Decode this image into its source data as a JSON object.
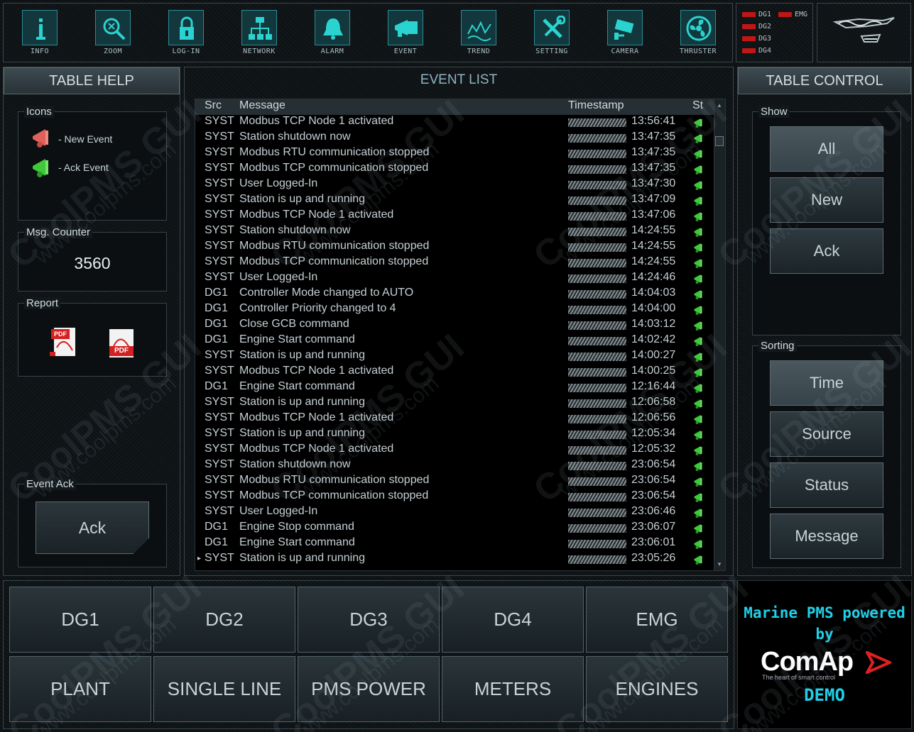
{
  "toolbar": {
    "items": [
      {
        "label": "INFO",
        "icon": "info-icon"
      },
      {
        "label": "ZOOM",
        "icon": "zoom-icon"
      },
      {
        "label": "LOG-IN",
        "icon": "lock-icon"
      },
      {
        "label": "NETWORK",
        "icon": "network-icon"
      },
      {
        "label": "ALARM",
        "icon": "bell-icon"
      },
      {
        "label": "EVENT",
        "icon": "horn-icon"
      },
      {
        "label": "TREND",
        "icon": "trend-icon"
      },
      {
        "label": "SETTING",
        "icon": "tools-icon"
      },
      {
        "label": "CAMERA",
        "icon": "camera-icon"
      },
      {
        "label": "THRUSTER",
        "icon": "fan-icon"
      }
    ]
  },
  "gen_status": {
    "dg1": "DG1",
    "dg2": "DG2",
    "dg3": "DG3",
    "dg4": "DG4",
    "emg": "EMG",
    "color": "#c11616"
  },
  "left": {
    "title": "TABLE HELP",
    "icons_title": "Icons",
    "new_event": "- New Event",
    "ack_event": "- Ack Event",
    "counter_title": "Msg. Counter",
    "counter_value": "3560",
    "report_title": "Report",
    "pdf1_label": "PDF",
    "pdf2_label": "PDF",
    "ack_title": "Event Ack",
    "ack_button": "Ack"
  },
  "center": {
    "title": "EVENT LIST",
    "columns": {
      "src": "Src",
      "message": "Message",
      "timestamp": "Timestamp",
      "status": "St"
    },
    "rows": [
      {
        "src": "SYST",
        "msg": "Modbus TCP Node 1 activated",
        "time": "13:56:41"
      },
      {
        "src": "SYST",
        "msg": "Station shutdown now",
        "time": "13:47:35"
      },
      {
        "src": "SYST",
        "msg": "Modbus RTU communication stopped",
        "time": "13:47:35"
      },
      {
        "src": "SYST",
        "msg": "Modbus TCP communication stopped",
        "time": "13:47:35"
      },
      {
        "src": "SYST",
        "msg": "User Logged-In",
        "time": "13:47:30"
      },
      {
        "src": "SYST",
        "msg": "Station is up and running",
        "time": "13:47:09"
      },
      {
        "src": "SYST",
        "msg": "Modbus TCP Node 1 activated",
        "time": "13:47:06"
      },
      {
        "src": "SYST",
        "msg": "Station shutdown now",
        "time": "14:24:55"
      },
      {
        "src": "SYST",
        "msg": "Modbus RTU communication stopped",
        "time": "14:24:55"
      },
      {
        "src": "SYST",
        "msg": "Modbus TCP communication stopped",
        "time": "14:24:55"
      },
      {
        "src": "SYST",
        "msg": "User Logged-In",
        "time": "14:24:46"
      },
      {
        "src": "DG1",
        "msg": "Controller Mode changed to AUTO",
        "time": "14:04:03"
      },
      {
        "src": "DG1",
        "msg": "Controller Priority changed to 4",
        "time": "14:04:00"
      },
      {
        "src": "DG1",
        "msg": "Close GCB command",
        "time": "14:03:12"
      },
      {
        "src": "DG1",
        "msg": "Engine Start command",
        "time": "14:02:42"
      },
      {
        "src": "SYST",
        "msg": "Station is up and running",
        "time": "14:00:27"
      },
      {
        "src": "SYST",
        "msg": "Modbus TCP Node 1 activated",
        "time": "14:00:25"
      },
      {
        "src": "DG1",
        "msg": "Engine Start command",
        "time": "12:16:44"
      },
      {
        "src": "SYST",
        "msg": "Station is up and running",
        "time": "12:06:58"
      },
      {
        "src": "SYST",
        "msg": "Modbus TCP Node 1 activated",
        "time": "12:06:56"
      },
      {
        "src": "SYST",
        "msg": "Station is up and running",
        "time": "12:05:34"
      },
      {
        "src": "SYST",
        "msg": "Modbus TCP Node 1 activated",
        "time": "12:05:32"
      },
      {
        "src": "SYST",
        "msg": "Station shutdown now",
        "time": "23:06:54"
      },
      {
        "src": "SYST",
        "msg": "Modbus RTU communication stopped",
        "time": "23:06:54"
      },
      {
        "src": "SYST",
        "msg": "Modbus TCP communication stopped",
        "time": "23:06:54"
      },
      {
        "src": "SYST",
        "msg": "User Logged-In",
        "time": "23:06:46"
      },
      {
        "src": "DG1",
        "msg": "Engine Stop command",
        "time": "23:06:07"
      },
      {
        "src": "DG1",
        "msg": "Engine Start command",
        "time": "23:06:01"
      },
      {
        "src": "SYST",
        "msg": "Station is up and running",
        "time": "23:05:26"
      }
    ]
  },
  "right": {
    "title": "TABLE CONTROL",
    "show_title": "Show",
    "show_all": "All",
    "show_new": "New",
    "show_ack": "Ack",
    "sort_title": "Sorting",
    "sort_time": "Time",
    "sort_source": "Source",
    "sort_status": "Status",
    "sort_message": "Message"
  },
  "nav": {
    "dg1": "DG1",
    "dg2": "DG2",
    "dg3": "DG3",
    "dg4": "DG4",
    "emg": "EMG",
    "plant": "PLANT",
    "single_line": "SINGLE LINE",
    "pms_power": "PMS POWER",
    "meters": "METERS",
    "engines": "ENGINES"
  },
  "brand": {
    "line1": "Marine PMS powered",
    "line2": "by",
    "company": "ComAp",
    "tagline": "The heart of smart control",
    "demo": "DEMO",
    "accent": "#20d0e8"
  },
  "watermark": {
    "text1": "CoolPMS GUI",
    "text2": "www.coolpms.com"
  }
}
